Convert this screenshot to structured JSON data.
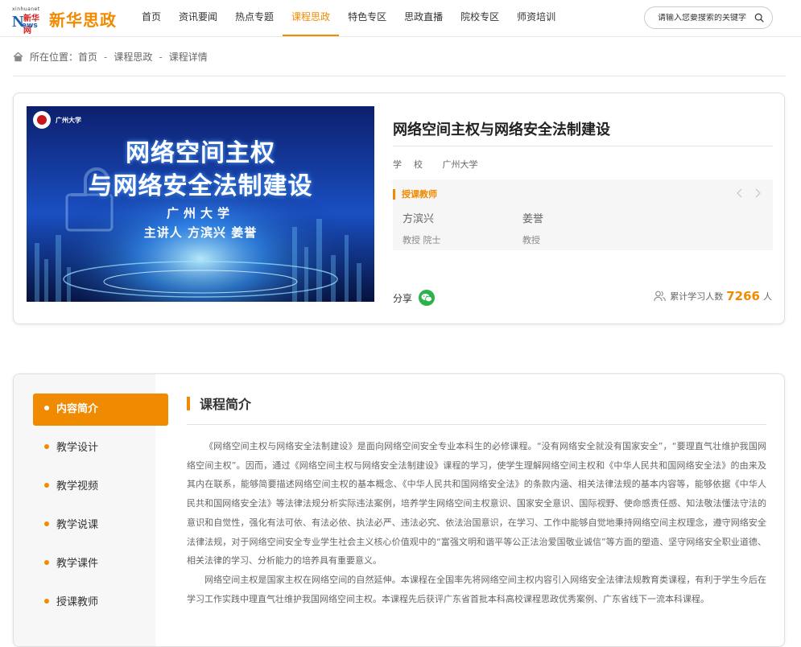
{
  "header": {
    "logo_small": "xinhuanet",
    "logo_cn": "新华网",
    "logo_n": "N",
    "logo_ews": "ews",
    "logo_text": "新华思政",
    "nav": [
      "首页",
      "资讯要闻",
      "热点专题",
      "课程思政",
      "特色专区",
      "思政直播",
      "院校专区",
      "师资培训"
    ],
    "active_nav": "课程思政",
    "search_placeholder": "请输入您要搜索的关键字"
  },
  "breadcrumb": {
    "prefix": "所在位置：",
    "items": [
      "首页",
      "课程思政",
      "课程详情"
    ],
    "separator": "-"
  },
  "course": {
    "cover": {
      "school_logo_text": "广州大学",
      "title_line1": "网络空间主权",
      "title_line2": "与网络安全法制建设",
      "school": "广州大学",
      "speakers": "主讲人 方滨兴 姜誉"
    },
    "title": "网络空间主权与网络安全法制建设",
    "school_label": "学校",
    "school": "广州大学",
    "teachers_label": "授课教师",
    "teachers": [
      {
        "name": "方滨兴",
        "role": "教授 院士"
      },
      {
        "name": "姜誉",
        "role": "教授"
      }
    ],
    "share_label": "分享",
    "learners_label": "累计学习人数",
    "learners_count": "7266",
    "learners_unit": "人"
  },
  "sidebar": {
    "items": [
      "内容简介",
      "教学设计",
      "教学视频",
      "教学说课",
      "教学课件",
      "授课教师"
    ],
    "active": "内容简介"
  },
  "intro": {
    "heading": "课程简介",
    "paragraphs": [
      "《网络空间主权与网络安全法制建设》是面向网络空间安全专业本科生的必修课程。“没有网络安全就没有国家安全”，“要理直气壮维护我国网络空间主权”。因而，通过《网络空间主权与网络安全法制建设》课程的学习，使学生理解网络空间主权和《中华人民共和国网络安全法》的由来及其内在联系，能够简要描述网络空间主权的基本概念、《中华人民共和国网络安全法》的条款内涵、相关法律法规的基本内容等，能够依据《中华人民共和国网络安全法》等法律法规分析实际违法案例，培养学生网络空间主权意识、国家安全意识、国际视野、使命感责任感、知法敬法懂法守法的意识和自觉性，强化有法可依、有法必依、执法必严、违法必究、依法治国意识，在学习、工作中能够自觉地秉持网络空间主权理念，遵守网络安全法律法规，对于网络空间安全专业学生社会主义核心价值观中的“富强文明和谐平等公正法治爱国敬业诚信”等方面的塑造、坚守网络安全职业道德、相关法律的学习、分析能力的培养具有重要意义。",
      "网络空间主权是国家主权在网络空间的自然延伸。本课程在全国率先将网络空间主权内容引入网络安全法律法规教育类课程，有利于学生今后在学习工作实践中理直气壮维护我国网络空间主权。本课程先后获评广东省首批本科高校课程思政优秀案例、广东省线下一流本科课程。"
    ]
  },
  "colors": {
    "accent": "#f08a00",
    "wechat": "#2bb24c"
  },
  "icons": [
    "home-icon",
    "search-icon",
    "wechat-icon",
    "users-icon",
    "chevron-left-icon",
    "chevron-right-icon"
  ]
}
